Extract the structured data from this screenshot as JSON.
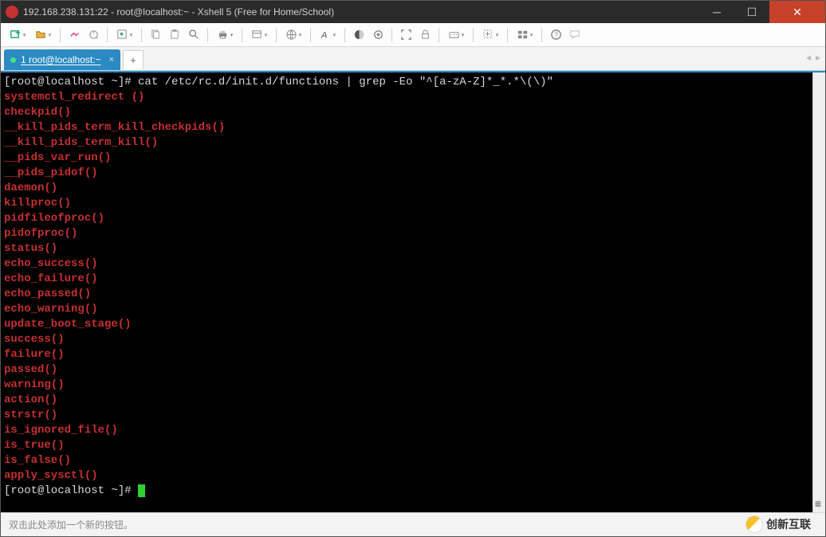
{
  "titlebar": {
    "text": "192.168.238.131:22 - root@localhost:~ - Xshell 5 (Free for Home/School)"
  },
  "tab": {
    "label": "1 root@localhost:~"
  },
  "statusbar": {
    "hint": "双击此处添加一个新的按钮。"
  },
  "watermark": {
    "text": "创新互联"
  },
  "terminal": {
    "prompt1": "[root@localhost ~]# ",
    "command": "cat /etc/rc.d/init.d/functions | grep -Eo \"^[a-zA-Z]*_*.*\\(\\)\"",
    "output": [
      "systemctl_redirect ()",
      "checkpid()",
      "__kill_pids_term_kill_checkpids()",
      "__kill_pids_term_kill()",
      "__pids_var_run()",
      "__pids_pidof()",
      "daemon()",
      "killproc()",
      "pidfileofproc()",
      "pidofproc()",
      "status()",
      "echo_success()",
      "echo_failure()",
      "echo_passed()",
      "echo_warning()",
      "update_boot_stage()",
      "success()",
      "failure()",
      "passed()",
      "warning()",
      "action()",
      "strstr()",
      "is_ignored_file()",
      "is_true()",
      "is_false()",
      "apply_sysctl()"
    ],
    "prompt2": "[root@localhost ~]# "
  }
}
